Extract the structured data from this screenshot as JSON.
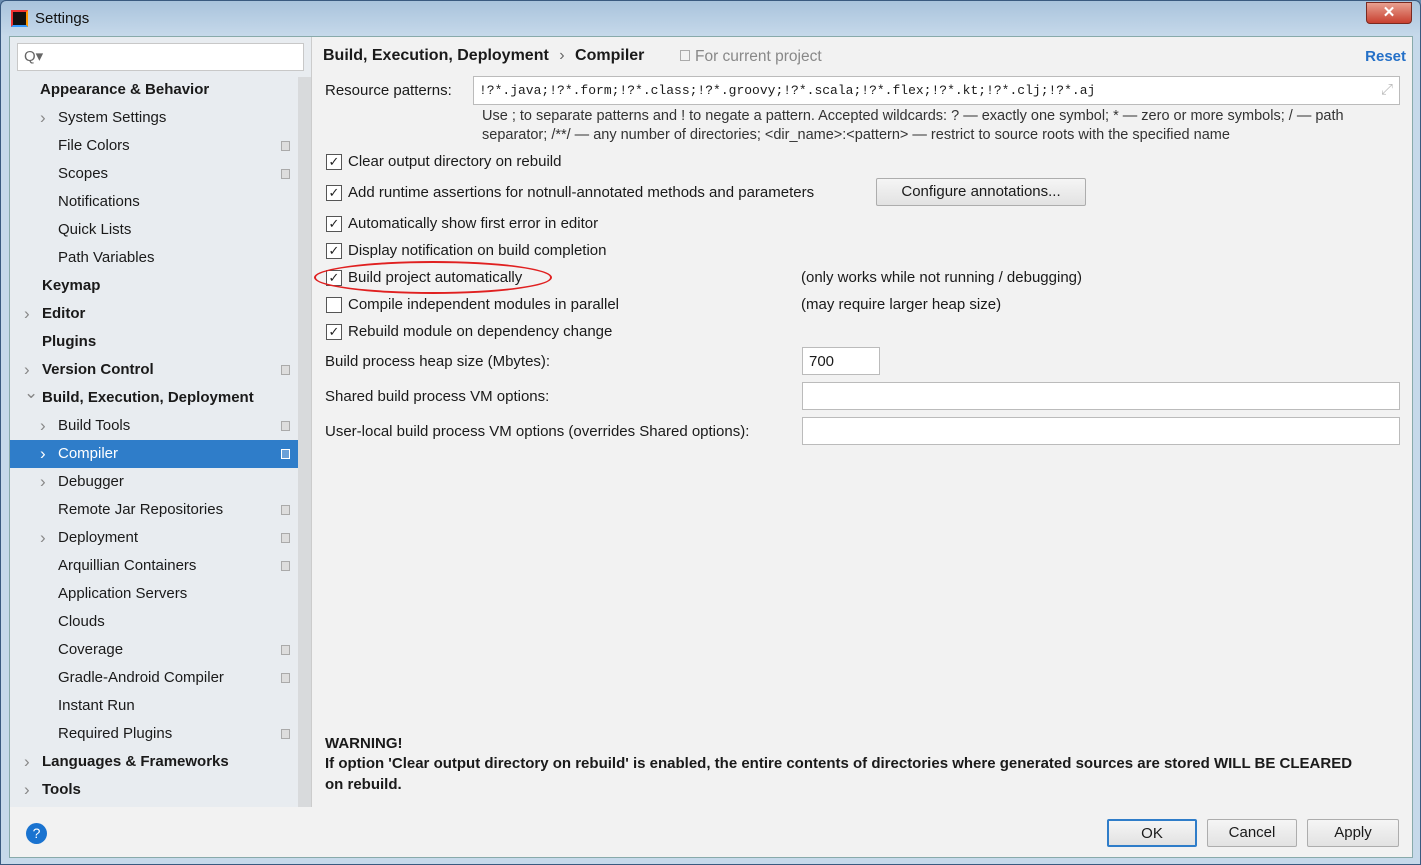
{
  "window": {
    "title": "Settings",
    "close": "✕"
  },
  "search": {
    "icon": "search-icon",
    "glyph": "Q▾"
  },
  "sidebar": {
    "items": [
      {
        "label": "Appearance & Behavior",
        "level": 0,
        "bold": true,
        "arrow": "none"
      },
      {
        "label": "System Settings",
        "level": 1,
        "arrow": "collapsed"
      },
      {
        "label": "File Colors",
        "level": 1,
        "arrow": "none",
        "project": true
      },
      {
        "label": "Scopes",
        "level": 1,
        "arrow": "none",
        "project": true
      },
      {
        "label": "Notifications",
        "level": 1,
        "arrow": "none"
      },
      {
        "label": "Quick Lists",
        "level": 1,
        "arrow": "none"
      },
      {
        "label": "Path Variables",
        "level": 1,
        "arrow": "none"
      },
      {
        "label": "Keymap",
        "level": 0,
        "bold": true,
        "arrow": "none"
      },
      {
        "label": "Editor",
        "level": 0,
        "bold": true,
        "arrow": "collapsed"
      },
      {
        "label": "Plugins",
        "level": 0,
        "bold": true,
        "arrow": "none"
      },
      {
        "label": "Version Control",
        "level": 0,
        "bold": true,
        "arrow": "collapsed",
        "project": true
      },
      {
        "label": "Build, Execution, Deployment",
        "level": 0,
        "bold": true,
        "arrow": "expanded"
      },
      {
        "label": "Build Tools",
        "level": 1,
        "arrow": "collapsed",
        "project": true
      },
      {
        "label": "Compiler",
        "level": 1,
        "arrow": "collapsed",
        "project": true,
        "selected": true
      },
      {
        "label": "Debugger",
        "level": 1,
        "arrow": "collapsed"
      },
      {
        "label": "Remote Jar Repositories",
        "level": 1,
        "arrow": "none",
        "project": true
      },
      {
        "label": "Deployment",
        "level": 1,
        "arrow": "collapsed",
        "project": true
      },
      {
        "label": "Arquillian Containers",
        "level": 1,
        "arrow": "none",
        "project": true
      },
      {
        "label": "Application Servers",
        "level": 1,
        "arrow": "none"
      },
      {
        "label": "Clouds",
        "level": 1,
        "arrow": "none"
      },
      {
        "label": "Coverage",
        "level": 1,
        "arrow": "none",
        "project": true
      },
      {
        "label": "Gradle-Android Compiler",
        "level": 1,
        "arrow": "none",
        "project": true
      },
      {
        "label": "Instant Run",
        "level": 1,
        "arrow": "none"
      },
      {
        "label": "Required Plugins",
        "level": 1,
        "arrow": "none",
        "project": true
      },
      {
        "label": "Languages & Frameworks",
        "level": 0,
        "bold": true,
        "arrow": "collapsed"
      },
      {
        "label": "Tools",
        "level": 0,
        "bold": true,
        "arrow": "collapsed"
      }
    ]
  },
  "header": {
    "breadcrumb_parent": "Build, Execution, Deployment",
    "separator": "›",
    "breadcrumb_current": "Compiler",
    "scope": "For current project",
    "reset": "Reset"
  },
  "resource": {
    "label": "Resource patterns:",
    "value": "!?*.java;!?*.form;!?*.class;!?*.groovy;!?*.scala;!?*.flex;!?*.kt;!?*.clj;!?*.aj",
    "hint1": "Use ; to separate patterns and ! to negate a pattern. Accepted wildcards: ? — exactly one symbol; * — zero or more symbols; / — path",
    "hint2": "separator; /**/ — any number of directories; <dir_name>:<pattern> — restrict to source roots with the specified name"
  },
  "options": [
    {
      "label": "Clear output directory on rebuild",
      "checked": true
    },
    {
      "label": "Add runtime assertions for notnull-annotated methods and parameters",
      "checked": true
    },
    {
      "label": "Automatically show first error in editor",
      "checked": true
    },
    {
      "label": "Display notification on build completion",
      "checked": true
    },
    {
      "label": "Build project automatically",
      "checked": true,
      "note": "(only works while not running / debugging)",
      "highlighted": true
    },
    {
      "label": "Compile independent modules in parallel",
      "checked": false,
      "note": "(may require larger heap size)"
    },
    {
      "label": "Rebuild module on dependency change",
      "checked": true
    }
  ],
  "configure_annotations": "Configure annotations...",
  "heap": {
    "label": "Build process heap size (Mbytes):",
    "value": "700"
  },
  "shared_vm": {
    "label": "Shared build process VM options:",
    "value": ""
  },
  "local_vm": {
    "label": "User-local build process VM options (overrides Shared options):",
    "value": ""
  },
  "warning": {
    "title": "WARNING!",
    "text": "If option 'Clear output directory on rebuild' is enabled, the entire contents of directories where generated sources are stored WILL BE CLEARED",
    "text2": "on rebuild."
  },
  "footer": {
    "help": "?",
    "ok": "OK",
    "cancel": "Cancel",
    "apply": "Apply"
  },
  "colors": {
    "selection": "#2f7dc9",
    "link": "#2470c8",
    "highlight_ring": "#e02020"
  }
}
